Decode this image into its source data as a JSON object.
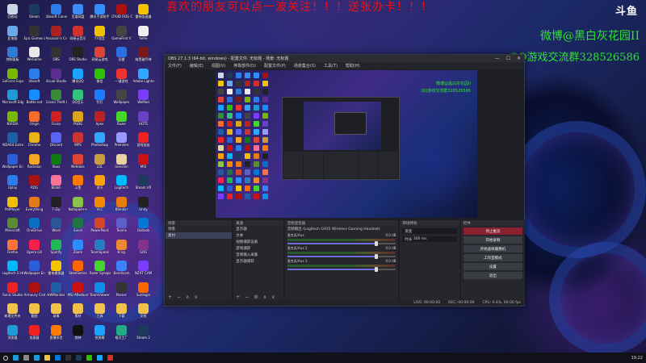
{
  "overlay": {
    "banner_top": "喜欢的朋友可以点一波关注！！！送张办卡！！！",
    "weibo": "微博@黑白灰花园II",
    "qq_group": "QQ游戏交流群328526586",
    "logo": "斗鱼"
  },
  "desktop": {
    "icons": [
      {
        "label": "回收站",
        "color": "#c9d7e6"
      },
      {
        "label": "Steam",
        "color": "#1b3a5c"
      },
      {
        "label": "Ubisoft Connect",
        "color": "#2b7de9"
      },
      {
        "label": "百度网盘",
        "color": "#3d8cf5"
      },
      {
        "label": "腾讯手游助手",
        "color": "#2f8fff"
      },
      {
        "label": "CPUID ROG CPU-Z",
        "color": "#a11"
      },
      {
        "label": "雷神加速器",
        "color": "#f5c400"
      },
      {
        "label": "此电脑",
        "color": "#6aa8e8"
      },
      {
        "label": "Epic Games Launcher",
        "color": "#333"
      },
      {
        "label": "Assassin's Creed",
        "color": "#aa2222"
      },
      {
        "label": "网易云音乐",
        "color": "#d0312d"
      },
      {
        "label": "YY语音",
        "color": "#f2c200"
      },
      {
        "label": "GameFirst V",
        "color": "#444"
      },
      {
        "label": "hehe",
        "color": "#eee"
      },
      {
        "label": "控制面板",
        "color": "#2e7bd6"
      },
      {
        "label": "WeGame",
        "color": "#e8e8e8"
      },
      {
        "label": "OBS",
        "color": "#333"
      },
      {
        "label": "OBS Studio",
        "color": "#222"
      },
      {
        "label": "网易云游戏",
        "color": "#d43"
      },
      {
        "label": "迅雷",
        "color": "#2a6fe0"
      },
      {
        "label": "暗黑破坏神",
        "color": "#7a1a1a"
      },
      {
        "label": "GeForce Experience",
        "color": "#76b900"
      },
      {
        "label": "Ubisoft",
        "color": "#2b7de9"
      },
      {
        "label": "Visual Studio",
        "color": "#5c2d91"
      },
      {
        "label": "腾讯QQ",
        "color": "#1aa3ff"
      },
      {
        "label": "微信",
        "color": "#2dc100"
      },
      {
        "label": "一键游戏",
        "color": "#e33"
      },
      {
        "label": "Adobe Lightroom",
        "color": "#31a8ff"
      },
      {
        "label": "Microsoft Edge",
        "color": "#1e9bd7"
      },
      {
        "label": "Battle.net",
        "color": "#148eff"
      },
      {
        "label": "Grand Theft Auto V",
        "color": "#3b8a3b"
      },
      {
        "label": "QQ音乐",
        "color": "#31c27c"
      },
      {
        "label": "钉钉",
        "color": "#1a7cff"
      },
      {
        "label": "Wallpaper",
        "color": "#444"
      },
      {
        "label": "WeMod",
        "color": "#7a3cff"
      },
      {
        "label": "NVIDIA",
        "color": "#76b900"
      },
      {
        "label": "Origin",
        "color": "#f56c2d"
      },
      {
        "label": "Forza",
        "color": "#c22"
      },
      {
        "label": "PUBG",
        "color": "#d9a31a"
      },
      {
        "label": "Apex",
        "color": "#b22"
      },
      {
        "label": "Razer",
        "color": "#44d62c"
      },
      {
        "label": "HOTS",
        "color": "#6b3fc6"
      },
      {
        "label": "AIDA64 Extreme",
        "color": "#1f5fa8"
      },
      {
        "label": "Chrome",
        "color": "#e8b31a"
      },
      {
        "label": "Discord",
        "color": "#5865f2"
      },
      {
        "label": "WPS",
        "color": "#c33"
      },
      {
        "label": "Photoshop",
        "color": "#31a8ff"
      },
      {
        "label": "Premiere",
        "color": "#9999ff"
      },
      {
        "label": "游戏加加",
        "color": "#e22"
      },
      {
        "label": "Wallpaper Engine",
        "color": "#2a5fd8"
      },
      {
        "label": "Rockstar",
        "color": "#f5a623"
      },
      {
        "label": "Xbox",
        "color": "#107c10"
      },
      {
        "label": "Netease",
        "color": "#d43"
      },
      {
        "label": "LOL",
        "color": "#c89b3c"
      },
      {
        "label": "Genshin",
        "color": "#e8d4a0"
      },
      {
        "label": "MSI",
        "color": "#c11"
      },
      {
        "label": "Uplay",
        "color": "#2b7de9"
      },
      {
        "label": "ROG",
        "color": "#a11"
      },
      {
        "label": "Bilibili",
        "color": "#fb7299"
      },
      {
        "label": "斗鱼",
        "color": "#ff7800"
      },
      {
        "label": "虎牙",
        "color": "#ffa200"
      },
      {
        "label": "Logitech",
        "color": "#00b8fc"
      },
      {
        "label": "Steam VR",
        "color": "#1b3a5c"
      },
      {
        "label": "PotPlayer",
        "color": "#f0c000"
      },
      {
        "label": "Everything",
        "color": "#e47a1a"
      },
      {
        "label": "7-Zip",
        "color": "#222"
      },
      {
        "label": "Notepad++",
        "color": "#8bc34a"
      },
      {
        "label": "VLC",
        "color": "#f58a00"
      },
      {
        "label": "Blender",
        "color": "#e87d0d"
      },
      {
        "label": "Unity",
        "color": "#222"
      },
      {
        "label": "Minecraft",
        "color": "#5b8c32"
      },
      {
        "label": "OneDrive",
        "color": "#0a6fc2"
      },
      {
        "label": "Word",
        "color": "#2b579a"
      },
      {
        "label": "Excel",
        "color": "#217346"
      },
      {
        "label": "PowerPoint",
        "color": "#d24726"
      },
      {
        "label": "Teams",
        "color": "#5b5fc7"
      },
      {
        "label": "Outlook",
        "color": "#0078d4"
      },
      {
        "label": "Firefox",
        "color": "#ff7139"
      },
      {
        "label": "Opera GX",
        "color": "#fa1e4e"
      },
      {
        "label": "Spotify",
        "color": "#1db954"
      },
      {
        "label": "Zoom",
        "color": "#2d8cff"
      },
      {
        "label": "TeamSpeak",
        "color": "#2580c3"
      },
      {
        "label": "Krisp",
        "color": "#e83"
      },
      {
        "label": "GOG",
        "color": "#86328a"
      },
      {
        "label": "Logitech G HUB",
        "color": "#00b8fc"
      },
      {
        "label": "Wallpaper Engine 壁纸",
        "color": "#2a5fd8"
      },
      {
        "label": "雷电模拟器",
        "color": "#f5c400"
      },
      {
        "label": "SteelSeries",
        "color": "#f60"
      },
      {
        "label": "Razer Synapse",
        "color": "#44d62c"
      },
      {
        "label": "Bandicam",
        "color": "#3b82f6"
      },
      {
        "label": "NZXT CAM",
        "color": "#7a3cff"
      },
      {
        "label": "Sonic Studio",
        "color": "#e22"
      },
      {
        "label": "Armoury Crate",
        "color": "#a11"
      },
      {
        "label": "HWMonitor",
        "color": "#1f5fa8"
      },
      {
        "label": "MSI Afterburner",
        "color": "#c11"
      },
      {
        "label": "TeamViewer",
        "color": "#0e8ee9"
      },
      {
        "label": "Parsec",
        "color": "#333"
      },
      {
        "label": "Sunlogin",
        "color": "#f60"
      },
      {
        "label": "新建文件夹",
        "color": "#f0c24a"
      },
      {
        "label": "截图",
        "color": "#f0c24a"
      },
      {
        "label": "录像",
        "color": "#f0c24a"
      },
      {
        "label": "素材",
        "color": "#f0c24a"
      },
      {
        "label": "工具",
        "color": "#f0c24a"
      },
      {
        "label": "下载",
        "color": "#f0c24a"
      },
      {
        "label": "文档",
        "color": "#f0c24a"
      },
      {
        "label": "浏览器",
        "color": "#1e9bd7"
      },
      {
        "label": "加速器",
        "color": "#e22"
      },
      {
        "label": "直播伴侣",
        "color": "#ff7800"
      },
      {
        "label": "剪映",
        "color": "#111"
      },
      {
        "label": "快剪辑",
        "color": "#1aa3ff"
      },
      {
        "label": "格式工厂",
        "color": "#2a8"
      },
      {
        "label": "Steam 2",
        "color": "#1b3a5c"
      }
    ]
  },
  "obs": {
    "title": "OBS 27.1.3 (64-bit, windows) - 配置文件: 无标题 - 场景: 无标题",
    "window_controls": [
      "—",
      "☐",
      "✕"
    ],
    "menu": [
      "文件(F)",
      "编辑(E)",
      "视图(V)",
      "停靠部件(D)",
      "配置文件(P)",
      "场景集合(S)",
      "工具(T)",
      "帮助(H)"
    ],
    "preview": {
      "green1": "微博@黑白灰花园II",
      "green2": "QQ游戏交流群328526586"
    },
    "docks": {
      "scenes": {
        "title": "场景",
        "items": [
          "场景",
          "素材"
        ],
        "selected": 1,
        "footer": [
          "+",
          "−",
          "∧",
          "∨"
        ]
      },
      "sources": {
        "title": "来源",
        "items": [
          "显示器",
          "文本",
          "视频捕获设备",
          "游戏捕获",
          "音频输入采集",
          "显示器捕获"
        ],
        "footer": [
          "+",
          "−",
          "⚙",
          "∧",
          "∨"
        ]
      },
      "mixer": {
        "title": "音频混音器",
        "header": "音频输出 (Logitech G935 Wireless Gaming Headset)",
        "tracks": [
          {
            "name": "麦克风/Aux",
            "db": "0.0 dB",
            "level": 0.82
          },
          {
            "name": "麦克风/Aux 2",
            "db": "0.0 dB",
            "level": 0.82
          },
          {
            "name": "麦克风/Aux 3",
            "db": "0.0 dB",
            "level": 0.82
          }
        ]
      },
      "transitions": {
        "title": "转场特效",
        "type": "渐变",
        "duration_label": "时长",
        "duration": "300 ms"
      },
      "controls": {
        "title": "控件",
        "buttons": [
          "停止推流",
          "开始录制",
          "开始虚拟摄像机",
          "工作室模式",
          "设置",
          "退出"
        ]
      }
    },
    "status": {
      "live": "LIVE: 00:00:00",
      "rec": "REC: 00:00:00",
      "cpu": "CPU: 0.4%, 60.00 fps"
    }
  },
  "taskbar": {
    "apps": [
      {
        "name": "start-icon",
        "color": "#1e9bd7"
      },
      {
        "name": "task-view-icon",
        "color": "#888"
      },
      {
        "name": "edge-icon",
        "color": "#1e9bd7"
      },
      {
        "name": "explorer-icon",
        "color": "#f0c24a"
      },
      {
        "name": "store-icon",
        "color": "#0078d4"
      },
      {
        "name": "obs-icon",
        "color": "#333"
      },
      {
        "name": "steam-icon",
        "color": "#1b3a5c"
      },
      {
        "name": "wechat-icon",
        "color": "#2dc100"
      },
      {
        "name": "qq-icon",
        "color": "#1aa3ff"
      },
      {
        "name": "netease-icon",
        "color": "#d0312d"
      }
    ],
    "time": "19:22"
  }
}
